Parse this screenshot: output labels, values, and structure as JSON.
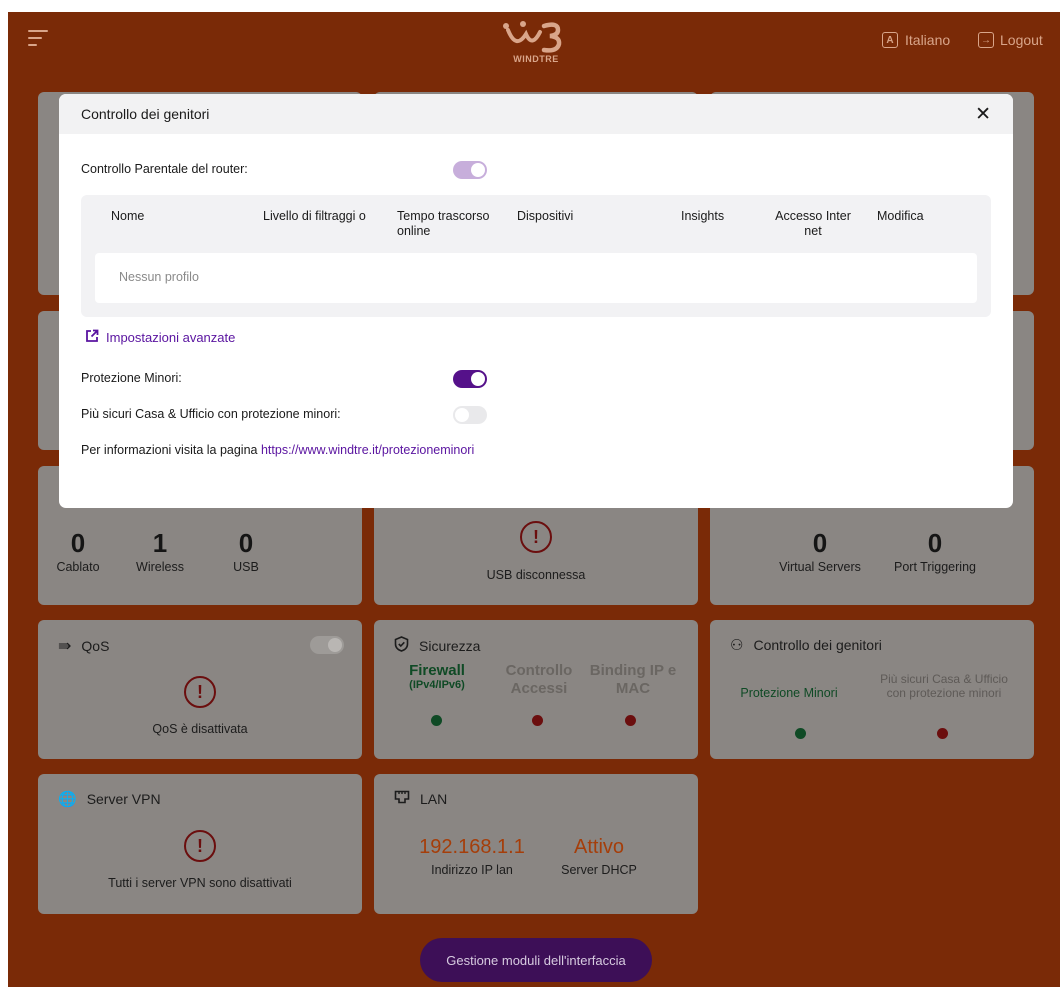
{
  "header": {
    "logo_text": "WINDTRE",
    "language_label": "Italiano",
    "language_icon_letter": "A",
    "logout_label": "Logout"
  },
  "cards": {
    "devices": {
      "counts": [
        {
          "value": "0",
          "label": "Cablato"
        },
        {
          "value": "1",
          "label": "Wireless"
        },
        {
          "value": "0",
          "label": "USB"
        }
      ]
    },
    "usb": {
      "status": "USB disconnessa"
    },
    "ports": {
      "counts": [
        {
          "value": "0",
          "label": "Virtual Servers"
        },
        {
          "value": "0",
          "label": "Port Triggering"
        }
      ]
    },
    "qos": {
      "title": "QoS",
      "status": "QoS è disattivata"
    },
    "security": {
      "title": "Sicurezza",
      "items": [
        {
          "label": "Firewall",
          "sub": "(IPv4/IPv6)",
          "state": "ok"
        },
        {
          "label": "Controllo Accessi",
          "state": "ko"
        },
        {
          "label": "Binding IP e MAC",
          "state": "ko"
        }
      ]
    },
    "parental": {
      "title": "Controllo dei genitori",
      "items": [
        {
          "label": "Protezione Minori",
          "state": "ok"
        },
        {
          "label": "Più sicuri Casa & Ufficio con protezione minori",
          "state": "ko"
        }
      ]
    },
    "vpn": {
      "title": "Server VPN",
      "status": "Tutti i server VPN sono disattivati"
    },
    "lan": {
      "title": "LAN",
      "ip_value": "192.168.1.1",
      "ip_label": "Indirizzo IP lan",
      "dhcp_value": "Attivo",
      "dhcp_label": "Server DHCP"
    }
  },
  "modules_button_label": "Gestione moduli dell'interfaccia",
  "modal": {
    "title": "Controllo dei genitori",
    "router_parental_label": "Controllo Parentale del router:",
    "router_parental_on": true,
    "table": {
      "headers": [
        "Nome",
        "Livello di filtraggi o",
        "Tempo trascorso online",
        "Dispositivi",
        "Insights",
        "Accesso Inter net",
        "Modifica"
      ],
      "empty_text": "Nessun profilo"
    },
    "advanced_link": "Impostazioni avanzate",
    "minor_protection_label": "Protezione Minori:",
    "minor_protection_on": true,
    "safer_label": "Più sicuri Casa & Ufficio con protezione minori:",
    "safer_on": false,
    "info_prefix": "Per informazioni visita la pagina",
    "info_link": "https://www.windtre.it/protezioneminori"
  },
  "colors": {
    "backdrop": "#7a2a07",
    "card": "#8a8683",
    "accent_purple": "#55118a",
    "link_purple": "#5a14a0",
    "orange_value": "#a53e0a",
    "ok_green": "#0f4a25",
    "ko_red": "#6b0e0e"
  }
}
